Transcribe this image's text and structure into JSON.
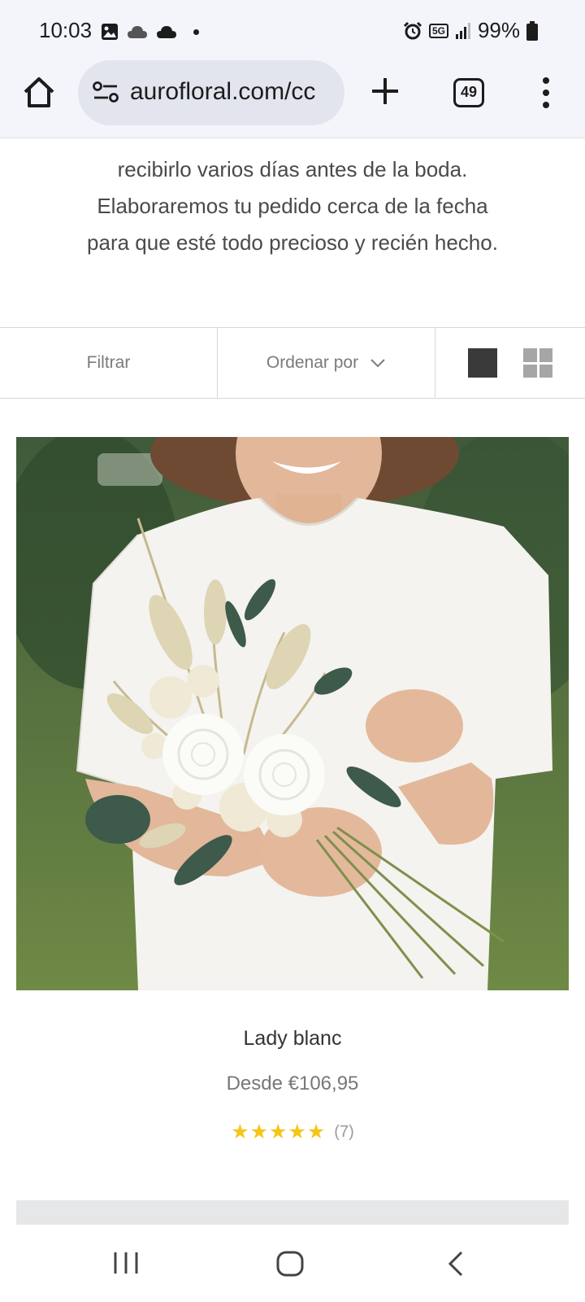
{
  "status_bar": {
    "time": "10:03",
    "battery": "99%",
    "network": "5G",
    "icons": [
      "image-icon",
      "cloud-icon",
      "cloud-icon",
      "dot-icon",
      "alarm-icon",
      "5g-icon",
      "signal-icon",
      "battery-icon"
    ]
  },
  "browser": {
    "url": "aurofloral.com/cc",
    "tab_count": "49",
    "icons": [
      "home-icon",
      "site-settings-icon",
      "new-tab-icon",
      "tab-switcher-icon",
      "more-menu-icon"
    ]
  },
  "intro": {
    "line1": "recibirlo varios días antes de la boda.",
    "line2": "Elaboraremos tu pedido cerca de la fecha",
    "line3": "para que esté todo precioso y recién hecho."
  },
  "toolbar": {
    "filter_label": "Filtrar",
    "sort_label": "Ordenar por"
  },
  "product": {
    "title": "Lady blanc",
    "price": "Desde €106,95",
    "rating": 5,
    "stars": "★★★★★",
    "review_count": "(7)"
  },
  "colors": {
    "browser_bg": "#f4f5fb",
    "url_pill": "#e2e4ee",
    "star": "#f5c518",
    "text": "#333333"
  }
}
